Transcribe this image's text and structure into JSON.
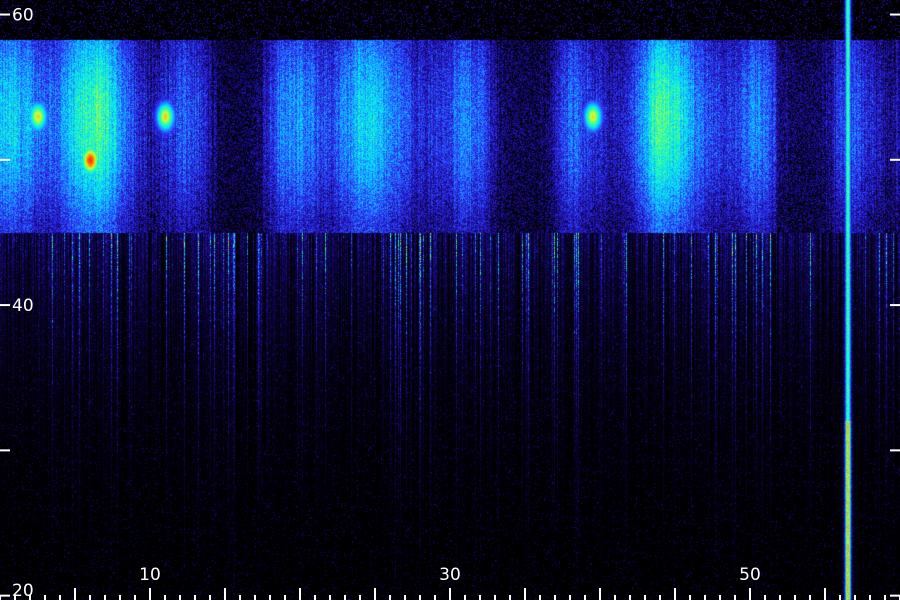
{
  "chart_data": {
    "type": "heatmap",
    "title": "",
    "xlabel": "",
    "ylabel": "",
    "x_tick_labels": [
      {
        "value": 10,
        "label": "10"
      },
      {
        "value": 30,
        "label": "30"
      },
      {
        "value": 50,
        "label": "50"
      }
    ],
    "x_ticks_major": [
      5,
      10,
      15,
      20,
      25,
      30,
      35,
      40,
      45,
      50,
      55
    ],
    "x_ticks_minor_step": 1,
    "xlim": [
      0,
      60
    ],
    "y_tick_labels": [
      {
        "value": 20,
        "label": "20"
      },
      {
        "value": 40,
        "label": "40"
      },
      {
        "value": 60,
        "label": "60"
      }
    ],
    "y_ticks": [
      20,
      30,
      40,
      50,
      60
    ],
    "ylim": [
      19.7,
      61.0
    ],
    "grid": false,
    "colormap": [
      "#000000",
      "#1a0a8c",
      "#2d2df5",
      "#1e8cff",
      "#00e6ff",
      "#33ff99",
      "#ccff33",
      "#ff9900",
      "#ff2200"
    ],
    "intensity_description": {
      "band_y_range": [
        45,
        58.5
      ],
      "band_intensity": 0.55,
      "hot_spots": [
        {
          "x": 6.0,
          "y": 50.0,
          "intensity": 0.98
        },
        {
          "x": 2.5,
          "y": 53.0,
          "intensity": 0.8
        },
        {
          "x": 11.0,
          "y": 53.0,
          "intensity": 0.8
        },
        {
          "x": 39.5,
          "y": 53.0,
          "intensity": 0.78
        }
      ],
      "strong_vertical_line": {
        "x": 56.5,
        "y_from": 19.7,
        "y_to": 61.0,
        "intensity": 0.85
      }
    }
  }
}
